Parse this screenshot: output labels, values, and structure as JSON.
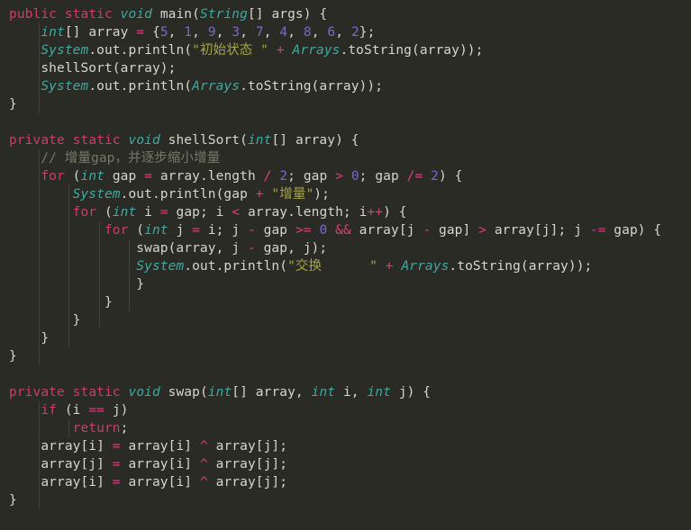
{
  "editor": {
    "language": "java",
    "theme": "dark-olive",
    "colors": {
      "background": "#2b2b26",
      "keyword": "#cc3d6b",
      "type": "#3fa9a0",
      "string": "#a5a34a",
      "number": "#7b68c8",
      "operator": "#d6407f",
      "comment": "#787868",
      "plain": "#d6d6cc",
      "indent_guide": "#4a4a40"
    },
    "lines": [
      {
        "indent": 0,
        "tokens": [
          {
            "t": "kw",
            "v": "public"
          },
          {
            "t": "plain",
            "v": " "
          },
          {
            "t": "kw",
            "v": "static"
          },
          {
            "t": "plain",
            "v": " "
          },
          {
            "t": "type",
            "v": "void"
          },
          {
            "t": "plain",
            "v": " main("
          },
          {
            "t": "cls",
            "v": "String"
          },
          {
            "t": "plain",
            "v": "[] args) {"
          }
        ]
      },
      {
        "indent": 1,
        "tokens": [
          {
            "t": "type",
            "v": "int"
          },
          {
            "t": "plain",
            "v": "[] array "
          },
          {
            "t": "op",
            "v": "="
          },
          {
            "t": "plain",
            "v": " {"
          },
          {
            "t": "num",
            "v": "5"
          },
          {
            "t": "plain",
            "v": ", "
          },
          {
            "t": "num",
            "v": "1"
          },
          {
            "t": "plain",
            "v": ", "
          },
          {
            "t": "num",
            "v": "9"
          },
          {
            "t": "plain",
            "v": ", "
          },
          {
            "t": "num",
            "v": "3"
          },
          {
            "t": "plain",
            "v": ", "
          },
          {
            "t": "num",
            "v": "7"
          },
          {
            "t": "plain",
            "v": ", "
          },
          {
            "t": "num",
            "v": "4"
          },
          {
            "t": "plain",
            "v": ", "
          },
          {
            "t": "num",
            "v": "8"
          },
          {
            "t": "plain",
            "v": ", "
          },
          {
            "t": "num",
            "v": "6"
          },
          {
            "t": "plain",
            "v": ", "
          },
          {
            "t": "num",
            "v": "2"
          },
          {
            "t": "plain",
            "v": "};"
          }
        ]
      },
      {
        "indent": 1,
        "tokens": [
          {
            "t": "cls",
            "v": "System"
          },
          {
            "t": "plain",
            "v": ".out.println("
          },
          {
            "t": "str",
            "v": "\"初始状态 \""
          },
          {
            "t": "plain",
            "v": " "
          },
          {
            "t": "op",
            "v": "+"
          },
          {
            "t": "plain",
            "v": " "
          },
          {
            "t": "cls",
            "v": "Arrays"
          },
          {
            "t": "plain",
            "v": ".toString(array));"
          }
        ]
      },
      {
        "indent": 1,
        "tokens": [
          {
            "t": "plain",
            "v": "shellSort(array);"
          }
        ]
      },
      {
        "indent": 1,
        "tokens": [
          {
            "t": "cls",
            "v": "System"
          },
          {
            "t": "plain",
            "v": ".out.println("
          },
          {
            "t": "cls",
            "v": "Arrays"
          },
          {
            "t": "plain",
            "v": ".toString(array));"
          }
        ]
      },
      {
        "indent": 0,
        "tokens": [
          {
            "t": "brace",
            "v": "}"
          }
        ]
      },
      {
        "indent": 0,
        "tokens": []
      },
      {
        "indent": 0,
        "tokens": [
          {
            "t": "kw",
            "v": "private"
          },
          {
            "t": "plain",
            "v": " "
          },
          {
            "t": "kw",
            "v": "static"
          },
          {
            "t": "plain",
            "v": " "
          },
          {
            "t": "type",
            "v": "void"
          },
          {
            "t": "plain",
            "v": " shellSort("
          },
          {
            "t": "type",
            "v": "int"
          },
          {
            "t": "plain",
            "v": "[] array) {"
          }
        ]
      },
      {
        "indent": 1,
        "tokens": [
          {
            "t": "cmt",
            "v": "// 增量gap，并逐步缩小增量"
          }
        ]
      },
      {
        "indent": 1,
        "tokens": [
          {
            "t": "kw",
            "v": "for"
          },
          {
            "t": "plain",
            "v": " ("
          },
          {
            "t": "type",
            "v": "int"
          },
          {
            "t": "plain",
            "v": " gap "
          },
          {
            "t": "op",
            "v": "="
          },
          {
            "t": "plain",
            "v": " array.length "
          },
          {
            "t": "op",
            "v": "/"
          },
          {
            "t": "plain",
            "v": " "
          },
          {
            "t": "num",
            "v": "2"
          },
          {
            "t": "plain",
            "v": "; gap "
          },
          {
            "t": "op",
            "v": ">"
          },
          {
            "t": "plain",
            "v": " "
          },
          {
            "t": "num",
            "v": "0"
          },
          {
            "t": "plain",
            "v": "; gap "
          },
          {
            "t": "op",
            "v": "/="
          },
          {
            "t": "plain",
            "v": " "
          },
          {
            "t": "num",
            "v": "2"
          },
          {
            "t": "plain",
            "v": ") {"
          }
        ]
      },
      {
        "indent": 2,
        "tokens": [
          {
            "t": "cls",
            "v": "System"
          },
          {
            "t": "plain",
            "v": ".out.println(gap "
          },
          {
            "t": "op",
            "v": "+"
          },
          {
            "t": "plain",
            "v": " "
          },
          {
            "t": "str",
            "v": "\"增量\""
          },
          {
            "t": "plain",
            "v": ");"
          }
        ]
      },
      {
        "indent": 2,
        "tokens": [
          {
            "t": "kw",
            "v": "for"
          },
          {
            "t": "plain",
            "v": " ("
          },
          {
            "t": "type",
            "v": "int"
          },
          {
            "t": "plain",
            "v": " i "
          },
          {
            "t": "op",
            "v": "="
          },
          {
            "t": "plain",
            "v": " gap; i "
          },
          {
            "t": "op",
            "v": "<"
          },
          {
            "t": "plain",
            "v": " array.length; i"
          },
          {
            "t": "op",
            "v": "++"
          },
          {
            "t": "plain",
            "v": ") {"
          }
        ]
      },
      {
        "indent": 3,
        "tokens": [
          {
            "t": "kw",
            "v": "for"
          },
          {
            "t": "plain",
            "v": " ("
          },
          {
            "t": "type",
            "v": "int"
          },
          {
            "t": "plain",
            "v": " j "
          },
          {
            "t": "op",
            "v": "="
          },
          {
            "t": "plain",
            "v": " i; j "
          },
          {
            "t": "op",
            "v": "-"
          },
          {
            "t": "plain",
            "v": " gap "
          },
          {
            "t": "op",
            "v": ">="
          },
          {
            "t": "plain",
            "v": " "
          },
          {
            "t": "num",
            "v": "0"
          },
          {
            "t": "plain",
            "v": " "
          },
          {
            "t": "op",
            "v": "&&"
          },
          {
            "t": "plain",
            "v": " array[j "
          },
          {
            "t": "op",
            "v": "-"
          },
          {
            "t": "plain",
            "v": " gap] "
          },
          {
            "t": "op",
            "v": ">"
          },
          {
            "t": "plain",
            "v": " array[j]; j "
          },
          {
            "t": "op",
            "v": "-="
          },
          {
            "t": "plain",
            "v": " gap) {"
          }
        ]
      },
      {
        "indent": 4,
        "tokens": [
          {
            "t": "plain",
            "v": "swap(array, j "
          },
          {
            "t": "op",
            "v": "-"
          },
          {
            "t": "plain",
            "v": " gap, j);"
          }
        ]
      },
      {
        "indent": 4,
        "tokens": [
          {
            "t": "cls",
            "v": "System"
          },
          {
            "t": "plain",
            "v": ".out.println("
          },
          {
            "t": "str",
            "v": "\"交换      \""
          },
          {
            "t": "plain",
            "v": " "
          },
          {
            "t": "op",
            "v": "+"
          },
          {
            "t": "plain",
            "v": " "
          },
          {
            "t": "cls",
            "v": "Arrays"
          },
          {
            "t": "plain",
            "v": ".toString(array));"
          }
        ]
      },
      {
        "indent": 4,
        "tokens": [
          {
            "t": "brace",
            "v": "}"
          }
        ]
      },
      {
        "indent": 3,
        "tokens": [
          {
            "t": "brace",
            "v": "}"
          }
        ]
      },
      {
        "indent": 2,
        "tokens": [
          {
            "t": "brace",
            "v": "}"
          }
        ]
      },
      {
        "indent": 1,
        "tokens": [
          {
            "t": "brace",
            "v": "}"
          }
        ]
      },
      {
        "indent": 0,
        "tokens": [
          {
            "t": "brace",
            "v": "}"
          }
        ]
      },
      {
        "indent": 0,
        "tokens": []
      },
      {
        "indent": 0,
        "tokens": [
          {
            "t": "kw",
            "v": "private"
          },
          {
            "t": "plain",
            "v": " "
          },
          {
            "t": "kw",
            "v": "static"
          },
          {
            "t": "plain",
            "v": " "
          },
          {
            "t": "type",
            "v": "void"
          },
          {
            "t": "plain",
            "v": " swap("
          },
          {
            "t": "type",
            "v": "int"
          },
          {
            "t": "plain",
            "v": "[] array, "
          },
          {
            "t": "type",
            "v": "int"
          },
          {
            "t": "plain",
            "v": " i, "
          },
          {
            "t": "type",
            "v": "int"
          },
          {
            "t": "plain",
            "v": " j) {"
          }
        ]
      },
      {
        "indent": 1,
        "tokens": [
          {
            "t": "kw",
            "v": "if"
          },
          {
            "t": "plain",
            "v": " (i "
          },
          {
            "t": "op",
            "v": "=="
          },
          {
            "t": "plain",
            "v": " j)"
          }
        ]
      },
      {
        "indent": 2,
        "tokens": [
          {
            "t": "kw",
            "v": "return"
          },
          {
            "t": "plain",
            "v": ";"
          }
        ]
      },
      {
        "indent": 1,
        "tokens": [
          {
            "t": "plain",
            "v": "array[i] "
          },
          {
            "t": "op",
            "v": "="
          },
          {
            "t": "plain",
            "v": " array[i] "
          },
          {
            "t": "op",
            "v": "^"
          },
          {
            "t": "plain",
            "v": " array[j];"
          }
        ]
      },
      {
        "indent": 1,
        "tokens": [
          {
            "t": "plain",
            "v": "array[j] "
          },
          {
            "t": "op",
            "v": "="
          },
          {
            "t": "plain",
            "v": " array[i] "
          },
          {
            "t": "op",
            "v": "^"
          },
          {
            "t": "plain",
            "v": " array[j];"
          }
        ]
      },
      {
        "indent": 1,
        "tokens": [
          {
            "t": "plain",
            "v": "array[i] "
          },
          {
            "t": "op",
            "v": "="
          },
          {
            "t": "plain",
            "v": " array[i] "
          },
          {
            "t": "op",
            "v": "^"
          },
          {
            "t": "plain",
            "v": " array[j];"
          }
        ]
      },
      {
        "indent": 0,
        "tokens": [
          {
            "t": "brace",
            "v": "}"
          }
        ]
      }
    ],
    "indent_guides": [
      {
        "level": 1,
        "top_line": 1,
        "bottom_line": 5
      },
      {
        "level": 1,
        "top_line": 8,
        "bottom_line": 19
      },
      {
        "level": 2,
        "top_line": 10,
        "bottom_line": 18
      },
      {
        "level": 3,
        "top_line": 12,
        "bottom_line": 17
      },
      {
        "level": 4,
        "top_line": 13,
        "bottom_line": 16
      },
      {
        "level": 1,
        "top_line": 22,
        "bottom_line": 27
      },
      {
        "level": 2,
        "top_line": 23,
        "bottom_line": 23
      }
    ]
  }
}
